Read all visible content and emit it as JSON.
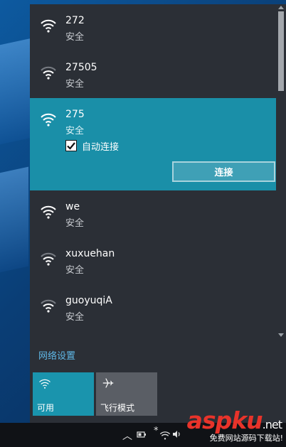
{
  "networks": [
    {
      "ssid": "272",
      "security": "安全",
      "signal": "full"
    },
    {
      "ssid": "27505",
      "security": "安全",
      "signal": "weak"
    },
    {
      "ssid": "275",
      "security": "安全",
      "signal": "full",
      "selected": true,
      "auto_connect_label": "自动连接",
      "auto_connect_checked": true,
      "connect_label": "连接"
    },
    {
      "ssid": "we",
      "security": "安全",
      "signal": "full"
    },
    {
      "ssid": "xuxuehan",
      "security": "安全",
      "signal": "weak"
    },
    {
      "ssid": "guoyuqiA",
      "security": "安全",
      "signal": "weak"
    }
  ],
  "network_settings_label": "网络设置",
  "quick_actions": {
    "wifi": {
      "label": "可用",
      "icon": "wifi-icon"
    },
    "airplane": {
      "label": "飞行模式",
      "icon": "airplane-icon"
    }
  },
  "taskbar": {
    "asterisk": "*"
  },
  "watermark": {
    "logo": "aspku",
    "tld": ".net",
    "tagline": "免费网站源码下载站!"
  },
  "colors": {
    "selected_bg": "#1a8fa8",
    "flyout_bg": "#2b2f36",
    "link": "#5fb7e6",
    "wifi_tile": "#1a94ad"
  }
}
